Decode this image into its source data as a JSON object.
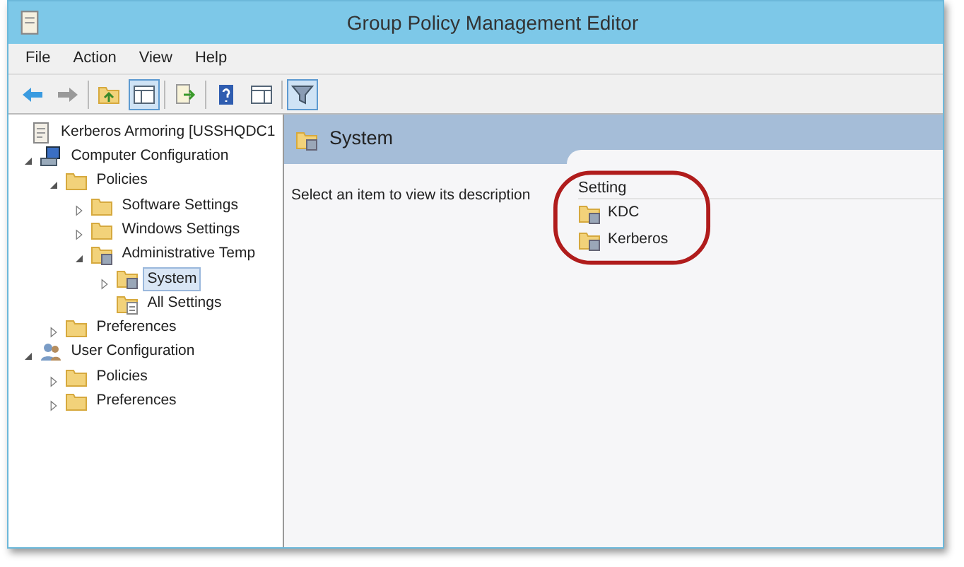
{
  "window": {
    "title": "Group Policy Management Editor"
  },
  "menu": [
    "File",
    "Action",
    "View",
    "Help"
  ],
  "toolbar": [
    {
      "kind": "back",
      "pressed": false
    },
    {
      "kind": "forward",
      "pressed": false
    },
    {
      "kind": "sep"
    },
    {
      "kind": "up",
      "pressed": false
    },
    {
      "kind": "tree",
      "pressed": true
    },
    {
      "kind": "sep"
    },
    {
      "kind": "export",
      "pressed": false
    },
    {
      "kind": "sep"
    },
    {
      "kind": "help",
      "pressed": false
    },
    {
      "kind": "pane",
      "pressed": false
    },
    {
      "kind": "sep"
    },
    {
      "kind": "filter",
      "pressed": true
    }
  ],
  "tree": [
    {
      "label": "Kerberos Armoring [USSHQDC1",
      "kind": "gpo",
      "selected": false,
      "children": [
        {
          "label": "Computer Configuration",
          "kind": "computer",
          "expanded": true,
          "selected": false,
          "children": [
            {
              "label": "Policies",
              "kind": "folder",
              "expanded": true,
              "selected": false,
              "children": [
                {
                  "label": "Software Settings",
                  "kind": "folder",
                  "expanded": false,
                  "selected": false
                },
                {
                  "label": "Windows Settings",
                  "kind": "folder",
                  "expanded": false,
                  "selected": false
                },
                {
                  "label": "Administrative Temp",
                  "kind": "policy",
                  "expanded": true,
                  "selected": false,
                  "children": [
                    {
                      "label": "System",
                      "kind": "policy",
                      "expanded": false,
                      "selected": true
                    },
                    {
                      "label": "All Settings",
                      "kind": "allsettings",
                      "selected": false
                    }
                  ]
                }
              ]
            },
            {
              "label": "Preferences",
              "kind": "folder",
              "expanded": false,
              "selected": false
            }
          ]
        },
        {
          "label": "User Configuration",
          "kind": "user",
          "expanded": true,
          "selected": false,
          "children": [
            {
              "label": "Policies",
              "kind": "folder",
              "expanded": false,
              "selected": false
            },
            {
              "label": "Preferences",
              "kind": "folder",
              "expanded": false,
              "selected": false
            }
          ]
        }
      ]
    }
  ],
  "details": {
    "title": "System",
    "description": "Select an item to view its description",
    "column": "Setting",
    "items": [
      {
        "label": "KDC",
        "selected": false
      },
      {
        "label": "Kerberos",
        "selected": false
      }
    ]
  }
}
